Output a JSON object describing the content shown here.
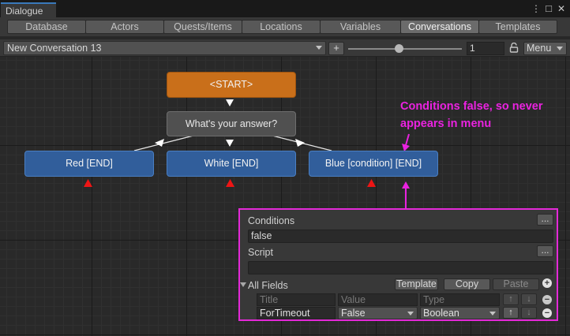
{
  "window": {
    "title": "Dialogue",
    "kebab_icon": "⋮",
    "maximize_icon": "□",
    "close_icon": "✕"
  },
  "tabs": [
    {
      "label": "Database"
    },
    {
      "label": "Actors"
    },
    {
      "label": "Quests/Items"
    },
    {
      "label": "Locations"
    },
    {
      "label": "Variables"
    },
    {
      "label": "Conversations",
      "active": true
    },
    {
      "label": "Templates"
    }
  ],
  "toolbar": {
    "conversation": "New Conversation 13",
    "add_label": "+",
    "zoom_value": 0.45,
    "zoom_field": "1",
    "lock_icon": "🔓",
    "menu_label": "Menu"
  },
  "graph": {
    "start_node": "<START>",
    "npc_node": "What's your answer?",
    "responses": [
      "Red [END]",
      "White [END]",
      "Blue [condition] [END]"
    ]
  },
  "annotation": {
    "line1": "Conditions false, so never",
    "line2": "appears in menu"
  },
  "inspector": {
    "conditions_label": "Conditions",
    "conditions_value": "false",
    "conditions_btn": "...",
    "script_label": "Script",
    "script_value": "",
    "script_btn": "...",
    "all_fields_label": "All Fields",
    "template_btn": "Template",
    "copy_btn": "Copy",
    "paste_btn": "Paste",
    "add_icon": "+",
    "remove_icon": "−",
    "field_headers": {
      "title": "Title",
      "value": "Value",
      "type": "Type"
    },
    "field_row": {
      "title": "ForTimeout",
      "value": "False",
      "type": "Boolean"
    },
    "up_icon": "↑",
    "down_icon": "↓"
  },
  "colors": {
    "start_node": "#c96f1a",
    "pc_node": "#315e9b",
    "npc_node": "#505050",
    "annotation": "#ea22e0",
    "warning_triangle": "#ee1515"
  }
}
